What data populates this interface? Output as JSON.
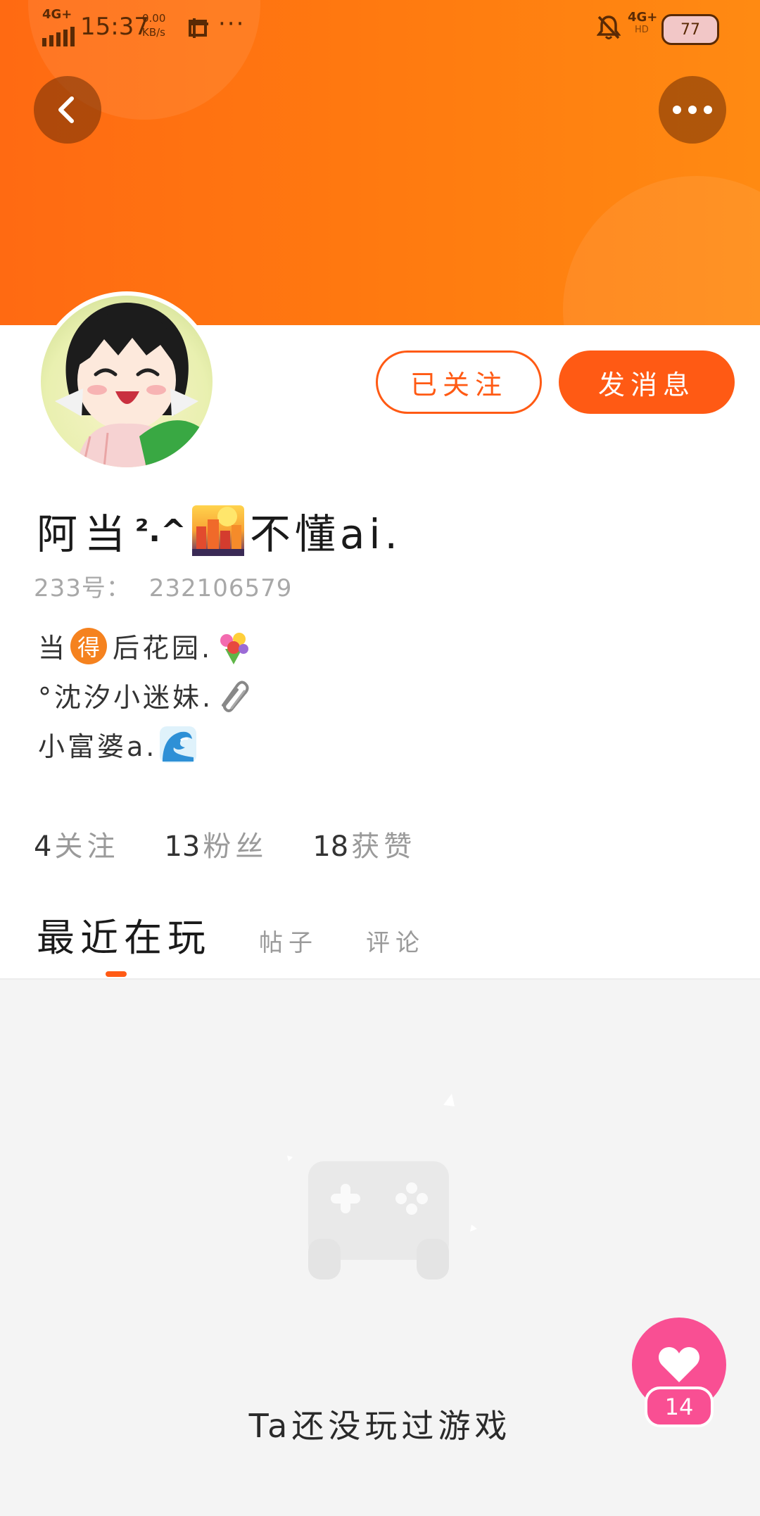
{
  "status_bar": {
    "network_left": "4G+",
    "time": "15:37",
    "speed_value": "0.00",
    "speed_unit": "KB/s",
    "more": "···",
    "network_right": "4G+",
    "network_right_sub": "HD",
    "battery": "77"
  },
  "profile": {
    "follow_button": "已关注",
    "message_button": "发消息",
    "name_before": "阿当",
    "name_mid": "².^",
    "name_after": "不懂ai.",
    "id_label": "233号：",
    "id_value": "232106579",
    "bio": {
      "line1_before": "当",
      "line1_badge": "得",
      "line1_after": "后花园.",
      "line2": "°沈汐小迷妹.",
      "line3": "小富婆a."
    }
  },
  "stats": [
    {
      "num": "4",
      "label": "关注"
    },
    {
      "num": "13",
      "label": "粉丝"
    },
    {
      "num": "18",
      "label": "获赞"
    }
  ],
  "tabs": {
    "active": "最近在玩",
    "posts": "帖子",
    "comments": "评论"
  },
  "empty_state": {
    "text": "Ta还没玩过游戏"
  },
  "like": {
    "count": "14"
  },
  "colors": {
    "accent": "#ff5a14",
    "like_pink": "#f94f93",
    "header_orange": "#ff7b10"
  }
}
